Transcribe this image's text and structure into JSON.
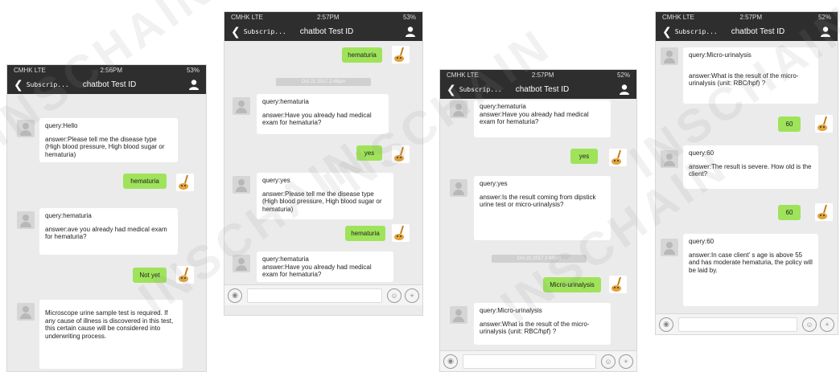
{
  "colors": {
    "bar": "#2e2e2e",
    "chat_bg": "#ebebeb",
    "green_bubble": "#9fe35a",
    "white_bubble": "#ffffff"
  },
  "watermark": "INSCHAIN",
  "screens": [
    {
      "status": {
        "carrier": "CMHK  LTE",
        "time": "2:56PM",
        "battery": "53%"
      },
      "nav": {
        "back": "Subscrip...",
        "title": "chatbot Test ID"
      },
      "messages": {
        "m1_query": "query:Hello",
        "m1_answer": "answer:Please tell me the disease type (High blood pressure, High blood sugar or hematuria)",
        "m2_user": "hematuria",
        "m3_query": "query:hematuria",
        "m3_answer": "answer:ave you already had medical exam for hematuria?",
        "m4_user": "Not yet",
        "m5_text": "Microscope urine sample test is required. If any cause of illness is discovered in this test, this certain cause will be considered into underwriting process."
      }
    },
    {
      "status": {
        "carrier": "CMHK  LTE",
        "time": "2:57PM",
        "battery": "53%"
      },
      "nav": {
        "back": "Subscrip...",
        "title": "chatbot Test ID"
      },
      "messages": {
        "m1_user": "hematuria",
        "timestamp": "Oct 21 2017  2:48pm",
        "m2_query": "query:hematuria",
        "m2_answer": "answer:Have you already had medical exam for hematuria?",
        "m3_user": "yes",
        "m4_query": "query:yes",
        "m4_answer": "answer:Please tell me the disease type (High blood pressure, High blood sugar or hematuria)",
        "m5_user": "hematuria",
        "m6_query": "query:hematuria",
        "m6_answer": "answer:Have you already had medical exam for hematuria?"
      }
    },
    {
      "status": {
        "carrier": "CMHK  LTE",
        "time": "2:57PM",
        "battery": "52%"
      },
      "nav": {
        "back": "Subscrip...",
        "title": "chatbot Test ID"
      },
      "messages": {
        "m1_query": "query:hematuria",
        "m1_answer": "answer:Have you already had medical exam for hematuria?",
        "m2_user": "yes",
        "m3_query": "query:yes",
        "m3_answer": "answer:Is the result coming from dipstick urine test or micro-urinalysis?",
        "timestamp": "Oct 21 2017  2:48pm",
        "m4_user": "Micro-urinalysis",
        "m5_query": "query:Micro-urinalysis",
        "m5_answer": "answer:What is the result of the micro-urinalysis (unit: RBC/hpf) ?"
      }
    },
    {
      "status": {
        "carrier": "CMHK  LTE",
        "time": "2:57PM",
        "battery": "52%"
      },
      "nav": {
        "back": "Subscrip...",
        "title": "chatbot Test ID"
      },
      "messages": {
        "m1_query": "query:Micro-urinalysis",
        "m1_answer": "answer:What is the result of the micro-urinalysis (unit: RBC/hpf) ?",
        "m2_user": "60",
        "m3_query": "query:60",
        "m3_answer": "answer:The result is severe. How old is the client?",
        "m4_user": "60",
        "m5_query": "query:60",
        "m5_answer": "answer:In case client’ s age is above 55 and has moderate hematuria, the policy will be laid by."
      }
    }
  ]
}
